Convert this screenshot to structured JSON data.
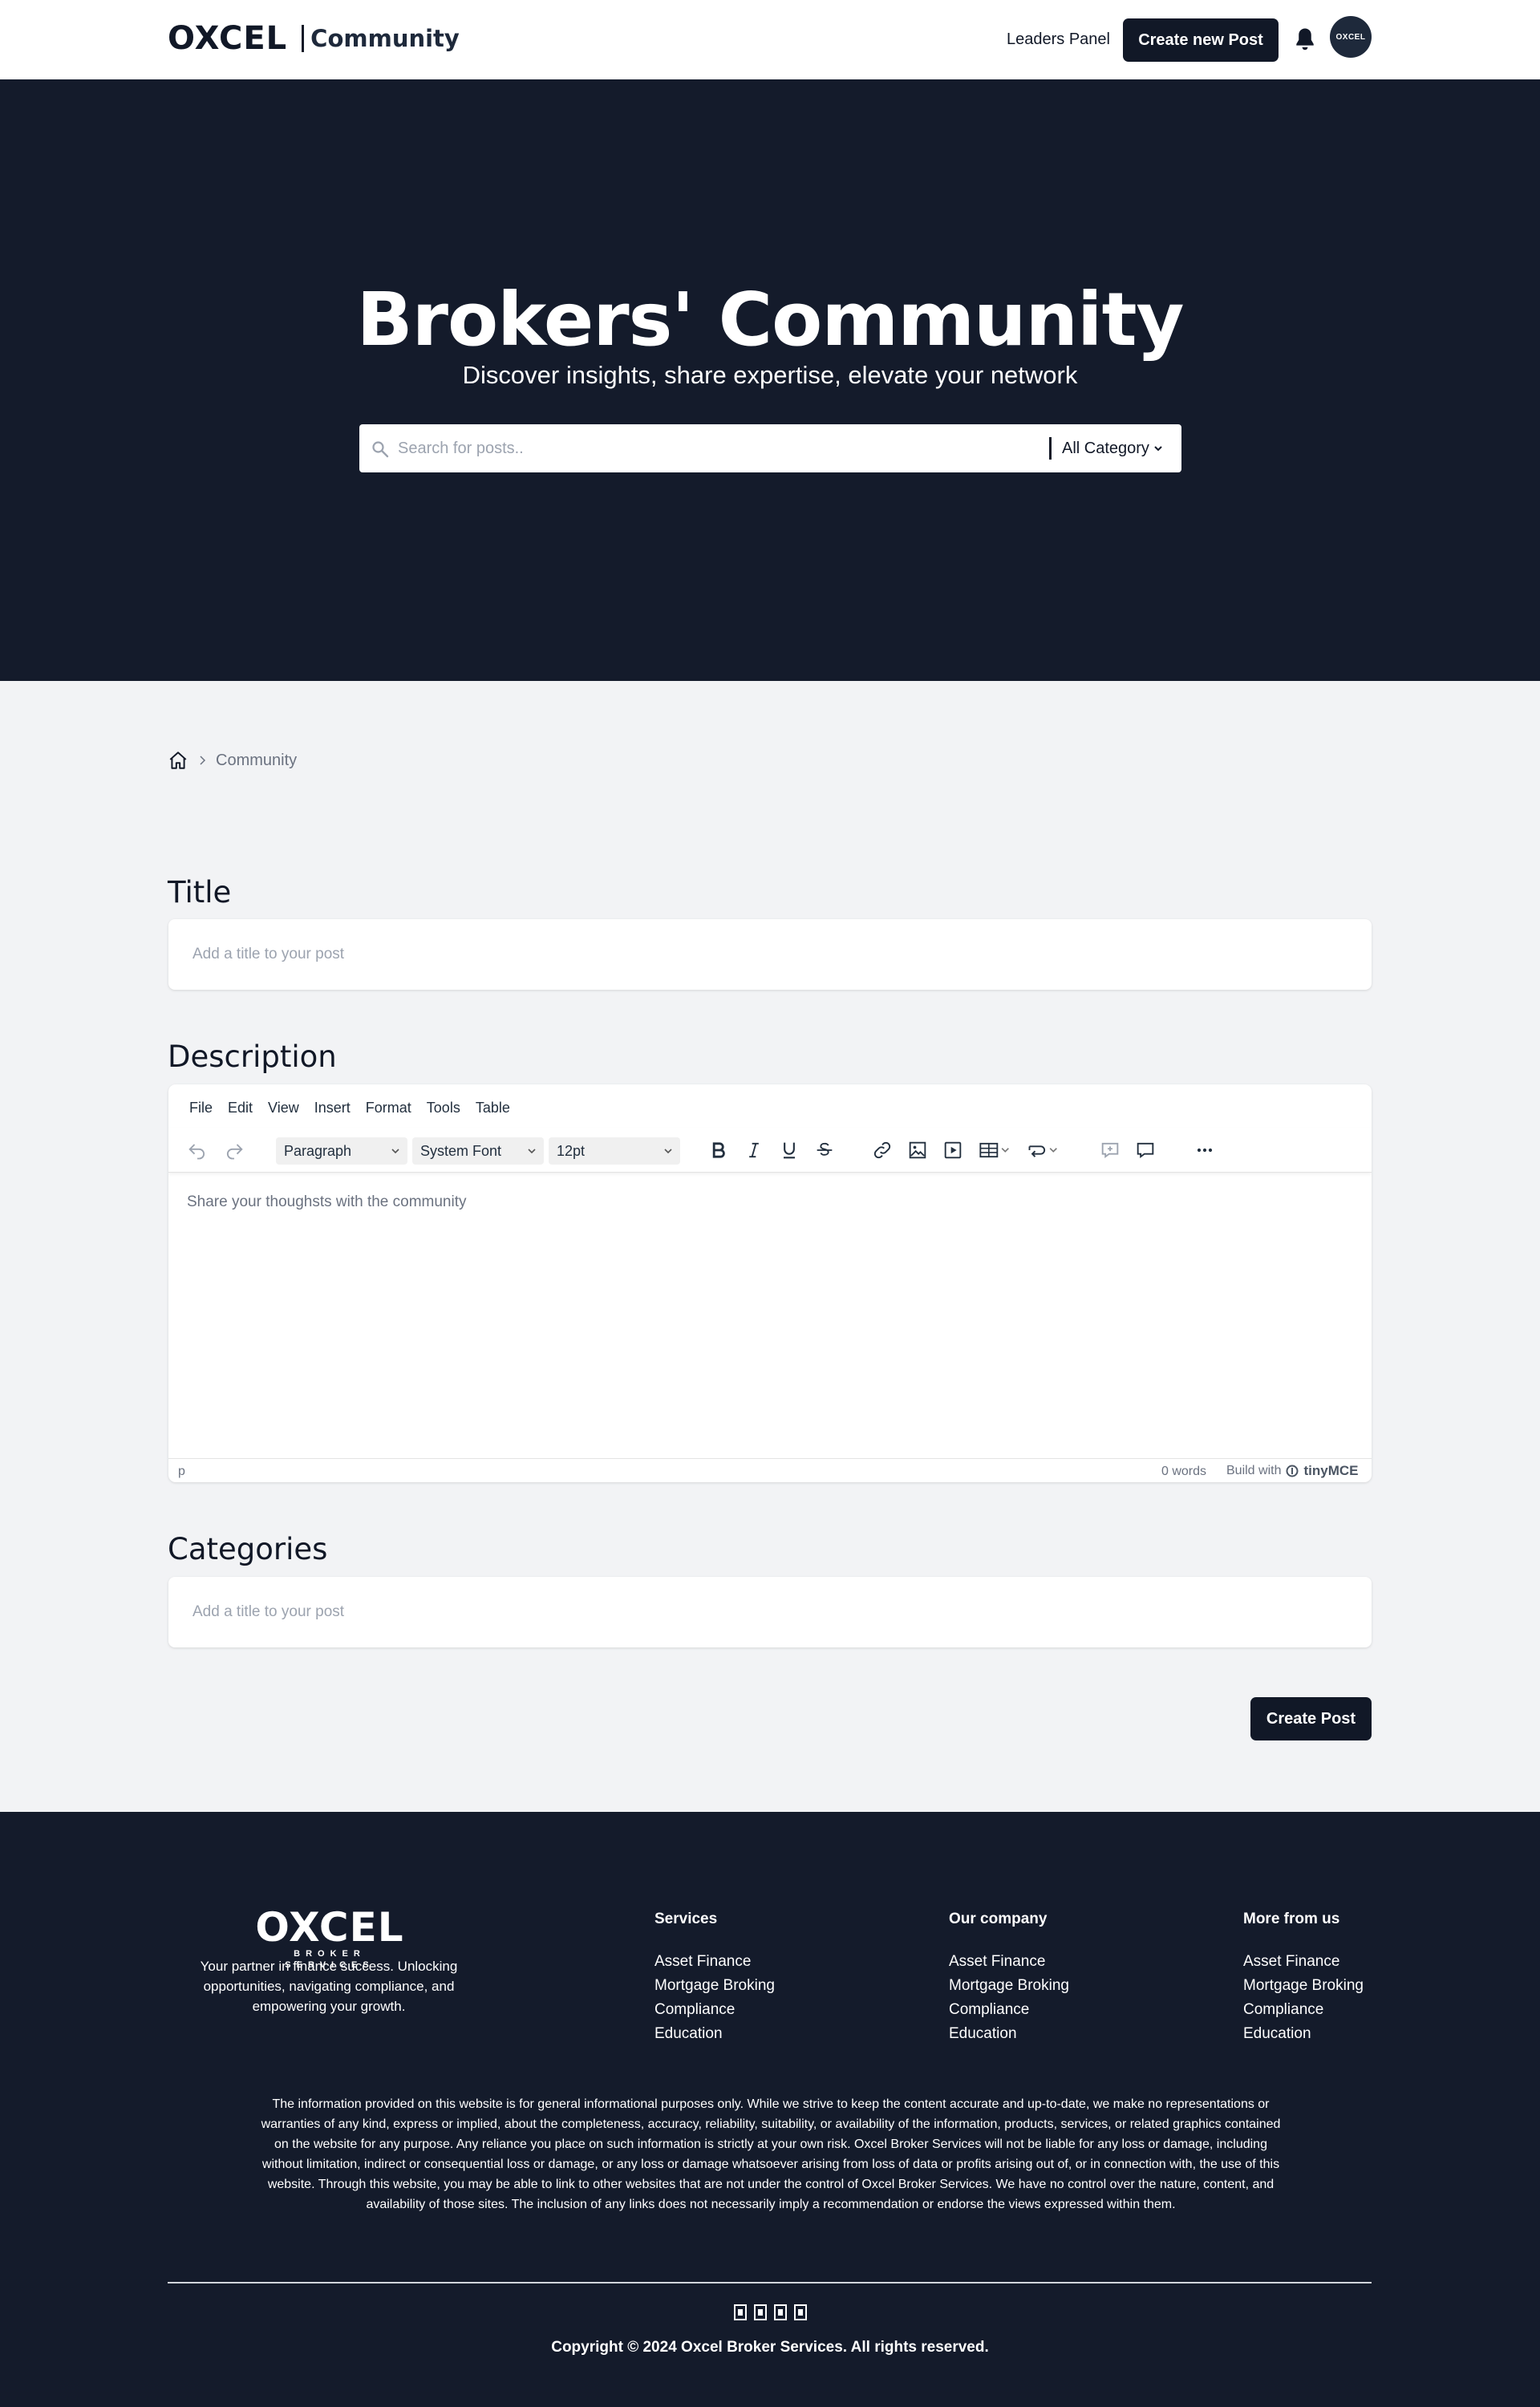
{
  "header": {
    "logo": "OXCEL",
    "logo_suffix": "Community",
    "leaders_panel": "Leaders Panel",
    "create_new_post": "Create new Post",
    "avatar_text": "OXCEL"
  },
  "hero": {
    "title": "Brokers' Community",
    "subtitle": "Discover insights, share expertise, elevate your network",
    "search_placeholder": "Search for posts..",
    "category_select": "All Category"
  },
  "breadcrumb": {
    "current": "Community"
  },
  "form": {
    "title_label": "Title",
    "title_placeholder": "Add a title to your post",
    "description_label": "Description",
    "editor": {
      "menu": [
        "File",
        "Edit",
        "View",
        "Insert",
        "Format",
        "Tools",
        "Table"
      ],
      "block_format": "Paragraph",
      "font_family": "System Font",
      "font_size": "12pt",
      "placeholder": "Share your thoughsts with the community",
      "status_path": "p",
      "word_count": "0 words",
      "build_with": "Build with",
      "brand": "tinyMCE"
    },
    "categories_label": "Categories",
    "categories_placeholder": "Add a title to your post",
    "submit": "Create Post"
  },
  "footer": {
    "logo": "OXCEL",
    "logo_sub": "BROKER SERVICES",
    "tagline": "Your partner in finance success. Unlocking opportunities, navigating compliance, and empowering your growth.",
    "columns": [
      {
        "heading": "Services",
        "items": [
          "Asset Finance",
          "Mortgage Broking",
          "Compliance",
          "Education"
        ]
      },
      {
        "heading": "Our company",
        "items": [
          "Asset Finance",
          "Mortgage Broking",
          "Compliance",
          "Education"
        ]
      },
      {
        "heading": "More from us",
        "items": [
          "Asset Finance",
          "Mortgage Broking",
          "Compliance",
          "Education"
        ]
      }
    ],
    "disclaimer": "The information provided on this website is for general informational purposes only. While we strive to keep the content accurate and up-to-date, we make no representations or warranties of any kind, express or implied, about the completeness, accuracy, reliability, suitability, or availability of the information, products, services, or related graphics contained on the website for any purpose. Any reliance you place on such information is strictly at your own risk. Oxcel Broker Services will not be liable for any loss or damage, including without limitation, indirect or consequential loss or damage, or any loss or damage whatsoever arising from loss of data or profits arising out of, or in connection with, the use of this website. Through this website, you may be able to link to other websites that are not under the control of Oxcel Broker Services. We have no control over the nature, content, and availability of those sites. The inclusion of any links does not necessarily imply a recommendation or endorse the views expressed within them.",
    "social_icons": [
      "social-icon-1",
      "social-icon-2",
      "social-icon-3",
      "social-icon-4"
    ],
    "copyright": "Copyright © 2024 Oxcel Broker Services. All rights reserved."
  }
}
